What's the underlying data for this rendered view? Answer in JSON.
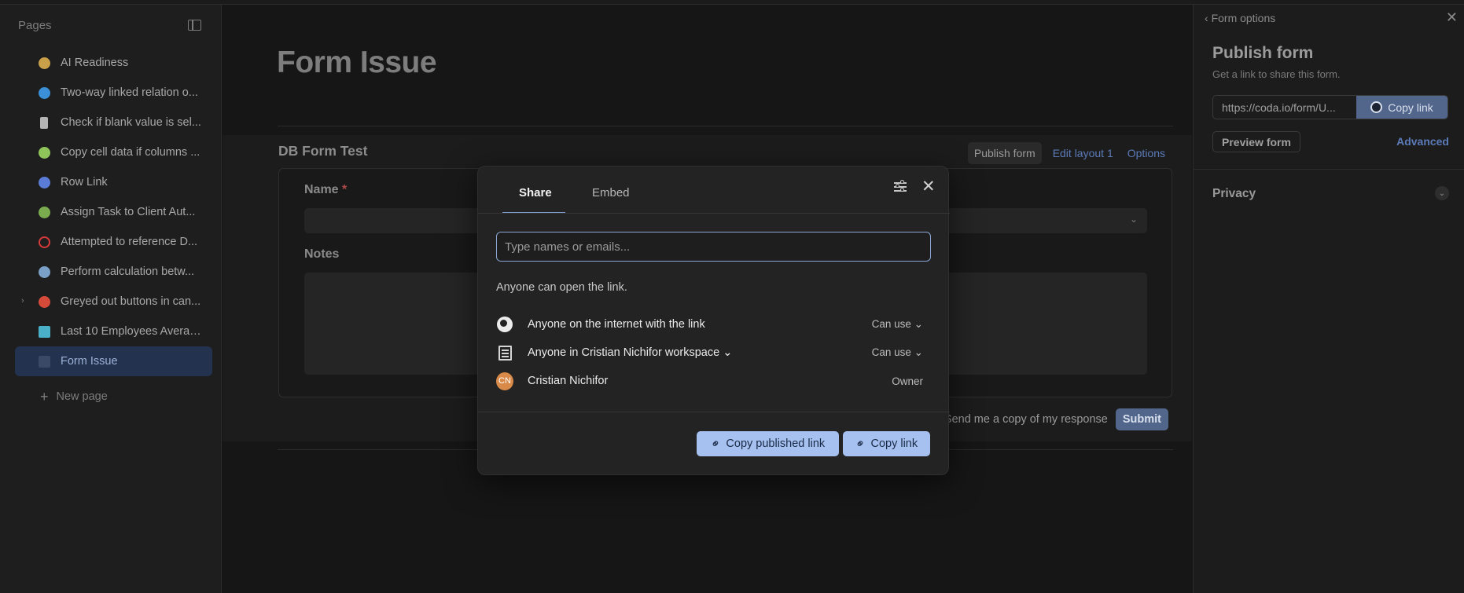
{
  "sidebar": {
    "header": "Pages",
    "items": [
      {
        "label": "AI Readiness",
        "icon": "brain-icon",
        "color": "#c9a04a"
      },
      {
        "label": "Two-way linked relation o...",
        "icon": "link-arrows-icon",
        "color": "#3a8fd6"
      },
      {
        "label": "Check if blank value is sel...",
        "icon": "phone-icon",
        "color": "#b5b5b5"
      },
      {
        "label": "Copy cell data if columns ...",
        "icon": "copy-icon",
        "color": "#8fc45a"
      },
      {
        "label": "Row Link",
        "icon": "row-link-icon",
        "color": "#5a7cd6"
      },
      {
        "label": "Assign Task to Client Aut...",
        "icon": "people-icon",
        "color": "#7aab4f"
      },
      {
        "label": "Attempted to reference D...",
        "icon": "no-entry-icon",
        "color": "#d63a3a"
      },
      {
        "label": "Perform calculation betw...",
        "icon": "calculator-icon",
        "color": "#7aa0c8"
      },
      {
        "label": "Greyed out buttons in can...",
        "icon": "red-circle-icon",
        "color": "#d64a3a"
      },
      {
        "label": "Last 10 Employees Average",
        "icon": "chart-icon",
        "color": "#4ab0c8"
      },
      {
        "label": "Form Issue",
        "icon": "form-icon",
        "color": "#3a4a66"
      }
    ],
    "new_page": "New page"
  },
  "main": {
    "title": "Form Issue",
    "form_title": "DB Form Test",
    "actions": {
      "publish": "Publish form",
      "edit_layout": "Edit layout 1",
      "options": "Options"
    },
    "fields": {
      "name_label": "Name",
      "required": "*",
      "notes_label": "Notes"
    },
    "footer": {
      "send_copy": "Send me a copy of my response",
      "submit": "Submit"
    }
  },
  "right_panel": {
    "back": "Form options",
    "title": "Publish form",
    "subtitle": "Get a link to share this form.",
    "url": "https://coda.io/form/U...",
    "copy_link": "Copy link",
    "preview": "Preview form",
    "advanced": "Advanced",
    "privacy": "Privacy"
  },
  "modal": {
    "tabs": {
      "share": "Share",
      "embed": "Embed"
    },
    "placeholder": "Type names or emails...",
    "note": "Anyone can open the link.",
    "rows": [
      {
        "label": "Anyone on the internet with the link",
        "perm": "Can use ⌄"
      },
      {
        "label": "Anyone in Cristian Nichifor workspace ⌄",
        "perm": "Can use ⌄"
      },
      {
        "label": "Cristian Nichifor",
        "perm": "Owner",
        "initials": "CN"
      }
    ],
    "copy_published": "Copy published link",
    "copy_link": "Copy link"
  }
}
